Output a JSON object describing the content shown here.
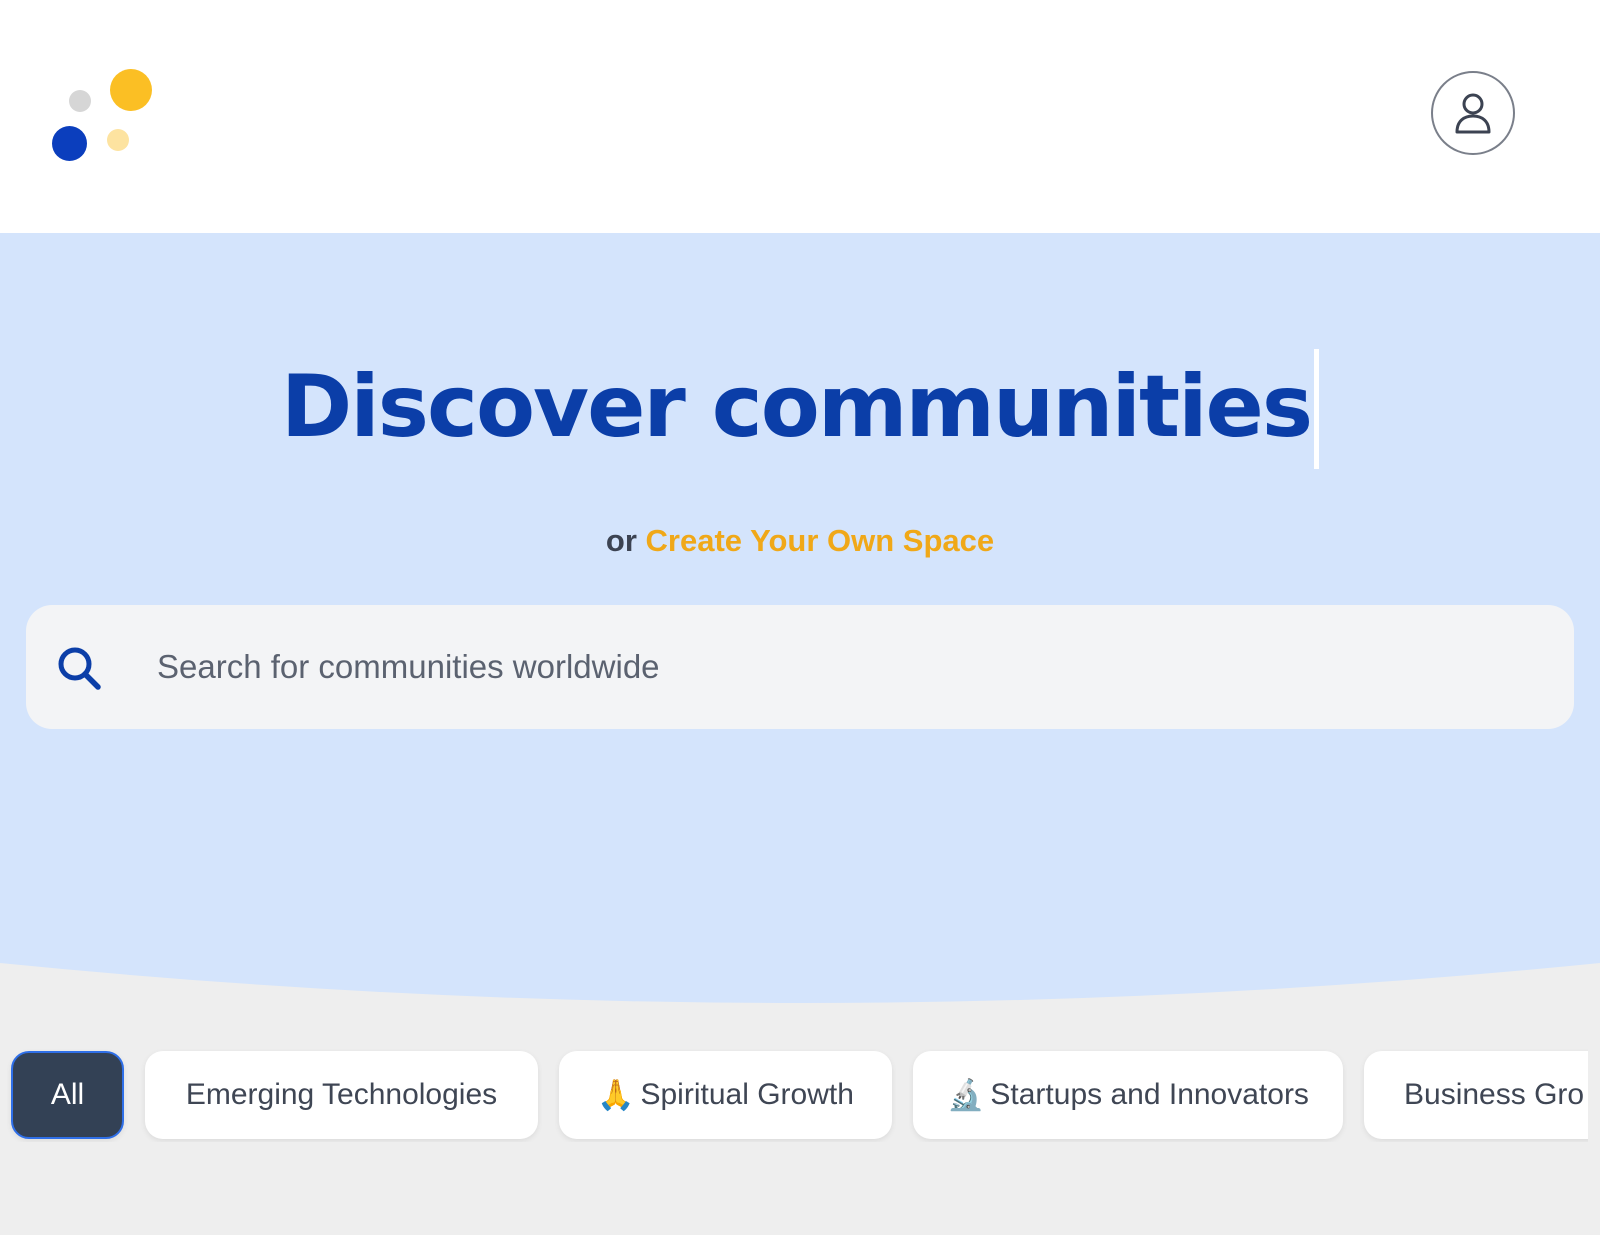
{
  "header": {
    "logo_name": "dots-logo",
    "profile_icon": "user-icon"
  },
  "hero": {
    "headline": "Discover communities",
    "subline_prefix": "or",
    "create_link": "Create Your Own Space",
    "search": {
      "placeholder": "Search for communities worldwide",
      "value": "",
      "icon": "search-icon"
    }
  },
  "categories": [
    {
      "label": "All",
      "emoji": "",
      "active": true
    },
    {
      "label": "Emerging Technologies",
      "emoji": "",
      "active": false
    },
    {
      "label": "Spiritual Growth",
      "emoji": "🙏",
      "active": false
    },
    {
      "label": "Startups and Innovators",
      "emoji": "🔬",
      "active": false
    },
    {
      "label": "Business Gro",
      "emoji": "",
      "active": false
    }
  ],
  "colors": {
    "brand_blue": "#0b3ea8",
    "accent_yellow": "#f0a818",
    "hero_bg": "#d4e4fc",
    "active_chip": "#334155"
  }
}
